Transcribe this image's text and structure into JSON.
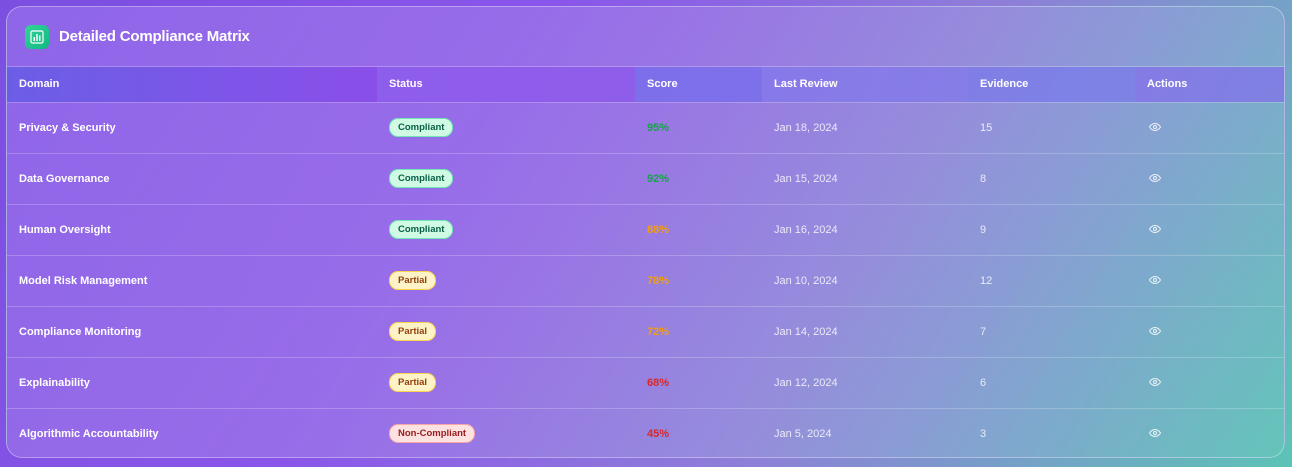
{
  "header": {
    "title": "Detailed Compliance Matrix",
    "icon": "bar-chart-icon"
  },
  "columns": [
    "Domain",
    "Status",
    "Score",
    "Last Review",
    "Evidence",
    "Actions"
  ],
  "status_colors": {
    "Compliant": "#d1fae5",
    "Partial": "#fef3c7",
    "Non-Compliant": "#fee2e2"
  },
  "rows": [
    {
      "domain": "Privacy & Security",
      "status": "Compliant",
      "score": "95%",
      "last_review": "Jan 18, 2024",
      "evidence": "15"
    },
    {
      "domain": "Data Governance",
      "status": "Compliant",
      "score": "92%",
      "last_review": "Jan 15, 2024",
      "evidence": "8"
    },
    {
      "domain": "Human Oversight",
      "status": "Compliant",
      "score": "88%",
      "last_review": "Jan 16, 2024",
      "evidence": "9"
    },
    {
      "domain": "Model Risk Management",
      "status": "Partial",
      "score": "78%",
      "last_review": "Jan 10, 2024",
      "evidence": "12"
    },
    {
      "domain": "Compliance Monitoring",
      "status": "Partial",
      "score": "72%",
      "last_review": "Jan 14, 2024",
      "evidence": "7"
    },
    {
      "domain": "Explainability",
      "status": "Partial",
      "score": "68%",
      "last_review": "Jan 12, 2024",
      "evidence": "6"
    },
    {
      "domain": "Algorithmic Accountability",
      "status": "Non-Compliant",
      "score": "45%",
      "last_review": "Jan 5, 2024",
      "evidence": "3"
    }
  ]
}
